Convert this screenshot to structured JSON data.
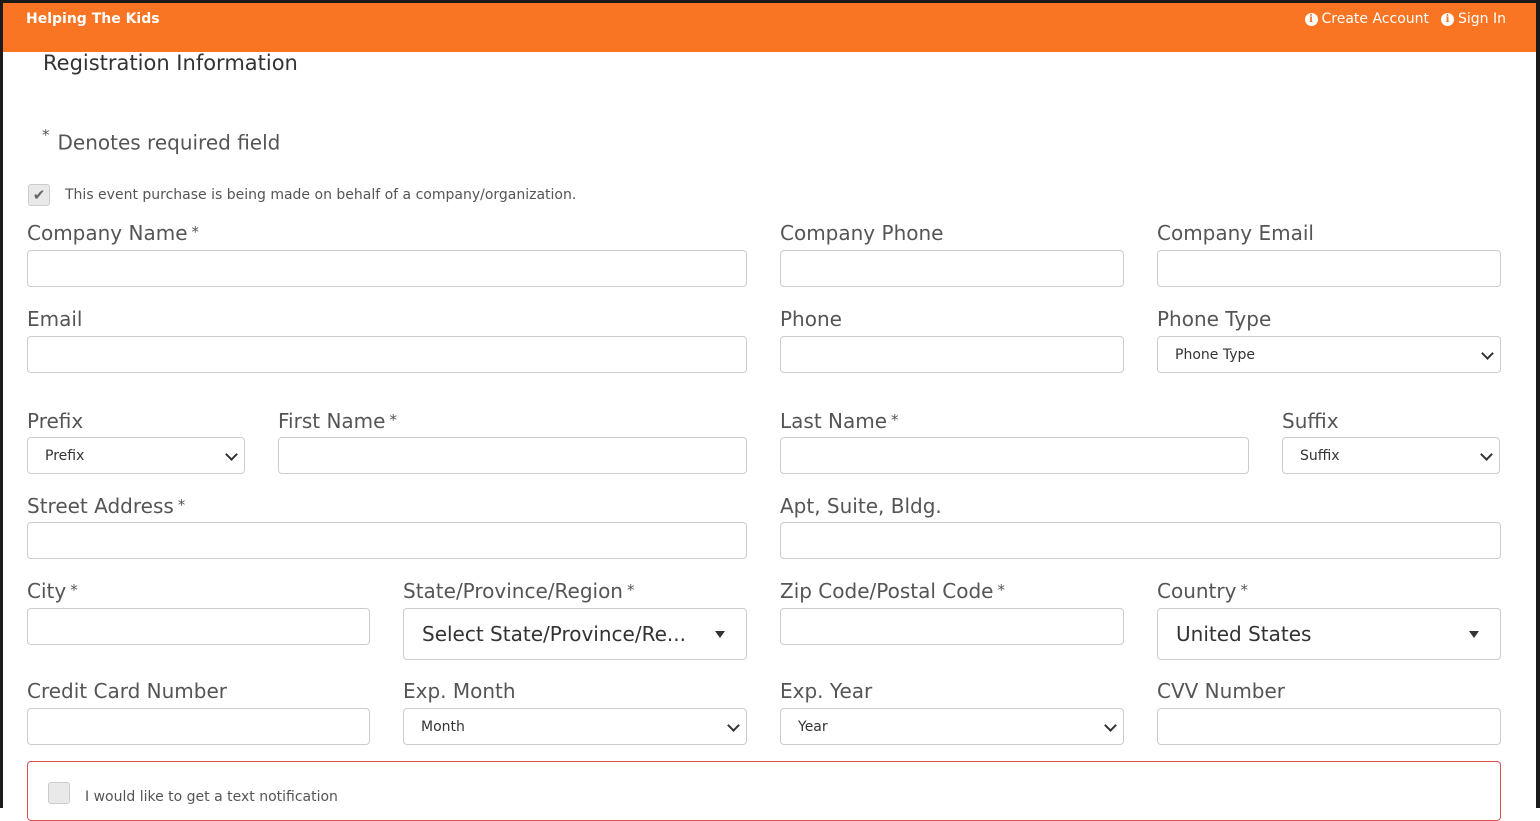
{
  "header": {
    "brand": "Helping The Kids",
    "links": [
      {
        "label": "Create Account",
        "icon": "info-circle-icon"
      },
      {
        "label": "Sign In",
        "icon": "info-circle-icon"
      }
    ],
    "color": "#f97523"
  },
  "page": {
    "title": "Registration Information",
    "required_note": "Denotes required field",
    "required_marker": "*"
  },
  "company_checkbox": {
    "checked": true,
    "label": "This event purchase is being made on behalf of a company/organization."
  },
  "fields": {
    "company_name": {
      "label": "Company Name",
      "value": ""
    },
    "company_phone": {
      "label": "Company Phone",
      "value": ""
    },
    "company_email": {
      "label": "Company Email",
      "value": ""
    },
    "email": {
      "label": "Email",
      "value": ""
    },
    "phone": {
      "label": "Phone",
      "value": ""
    },
    "phone_type": {
      "label": "Phone Type",
      "selected": "Phone Type"
    },
    "prefix": {
      "label": "Prefix",
      "selected": "Prefix"
    },
    "first_name": {
      "label": "First Name",
      "value": ""
    },
    "last_name": {
      "label": "Last Name",
      "value": ""
    },
    "suffix": {
      "label": "Suffix",
      "selected": "Suffix"
    },
    "street_address": {
      "label": "Street Address",
      "value": ""
    },
    "apt": {
      "label": "Apt, Suite, Bldg.",
      "value": ""
    },
    "city": {
      "label": "City",
      "value": ""
    },
    "state": {
      "label": "State/Province/Region",
      "selected": "Select State/Province/Re..."
    },
    "zip": {
      "label": "Zip Code/Postal Code",
      "value": ""
    },
    "country": {
      "label": "Country",
      "selected": "United States"
    },
    "cc_number": {
      "label": "Credit Card Number",
      "value": ""
    },
    "exp_month": {
      "label": "Exp. Month",
      "selected": "Month"
    },
    "exp_year": {
      "label": "Exp. Year",
      "selected": "Year"
    },
    "cvv": {
      "label": "CVV Number",
      "value": ""
    }
  },
  "notification": {
    "checked": false,
    "label": "I would like to get a text notification",
    "border_color": "#d9534f"
  }
}
